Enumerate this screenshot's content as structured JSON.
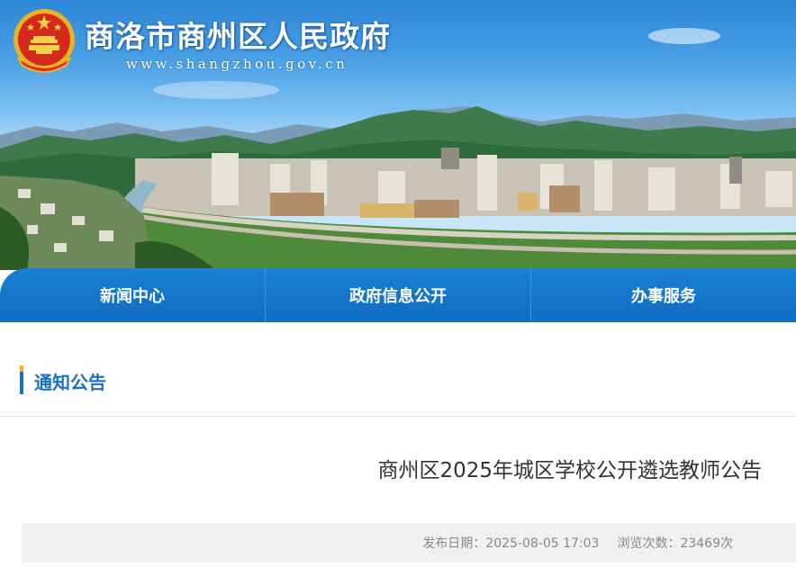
{
  "header": {
    "site_title": "商洛市商州区人民政府",
    "site_url": "www.shangzhou.gov.cn",
    "emblem_icon": "national-emblem-icon"
  },
  "nav": {
    "items": [
      {
        "label": "新闻中心"
      },
      {
        "label": "政府信息公开"
      },
      {
        "label": "办事服务"
      }
    ]
  },
  "section": {
    "title": "通知公告"
  },
  "article": {
    "title": "商州区2025年城区学校公开遴选教师公告",
    "publish_label": "发布日期：",
    "publish_date": "2025-08-05 17:03",
    "views_label": "浏览次数：",
    "views_count": "23469",
    "views_unit": "次"
  },
  "colors": {
    "nav_blue": "#0f6cc2",
    "accent_blue": "#1a6fc4",
    "accent_gold": "#f0b828",
    "meta_bg": "#f0f0f0"
  }
}
